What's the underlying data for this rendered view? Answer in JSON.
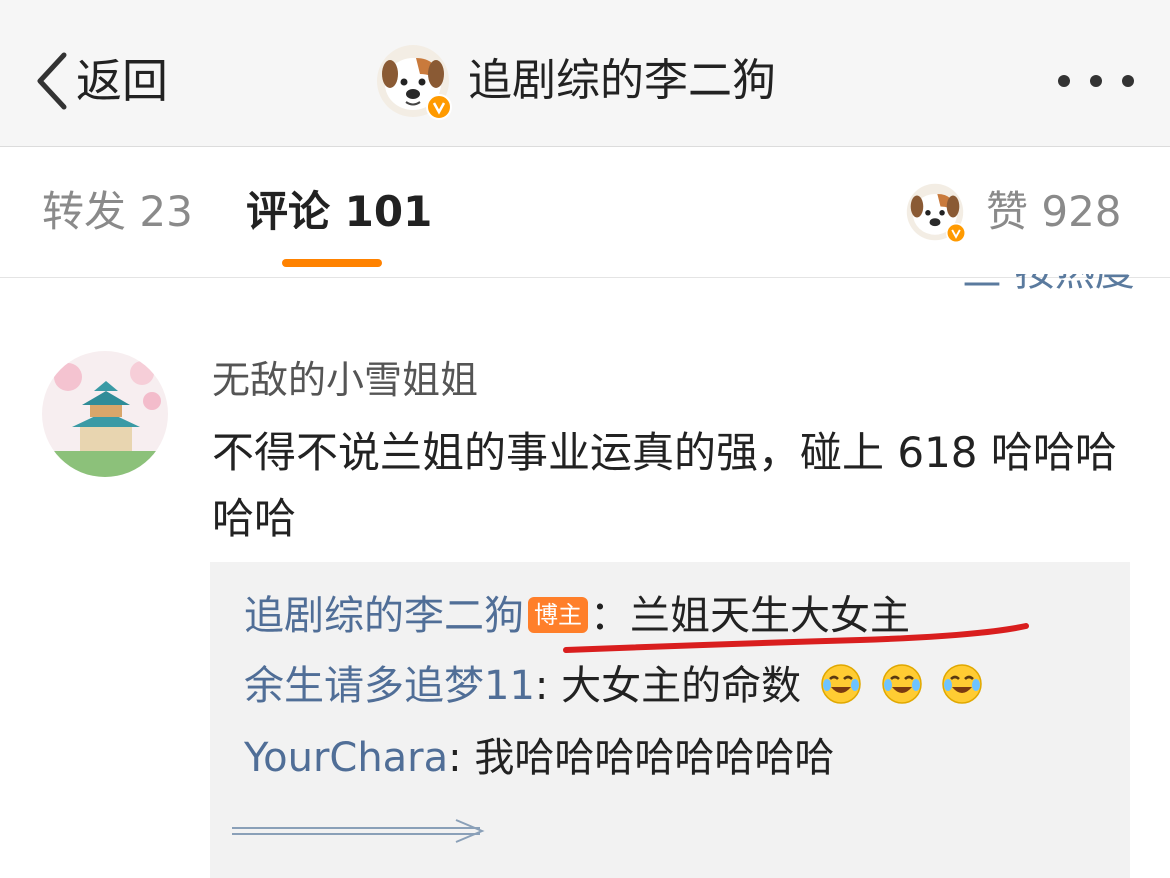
{
  "nav": {
    "back_label": "返回",
    "title": "追剧综的李二狗"
  },
  "tabs": {
    "repost": "转发 23",
    "comment": "评论 101",
    "like": "赞 928",
    "sort_peek": "三 按热度"
  },
  "comment": {
    "username": "无敌的小雪姐姐",
    "text": "不得不说兰姐的事业运真的强，碰上 618 哈哈哈哈哈",
    "replies": [
      {
        "name": "追剧综的李二狗",
        "badge": "博主",
        "sep": "：",
        "text": "兰姐天生大女主"
      },
      {
        "name": "余生请多追梦11",
        "sep": ": ",
        "text": "大女主的命数"
      },
      {
        "name": "YourChara",
        "sep": ": ",
        "text": "我哈哈哈哈哈哈哈哈"
      }
    ]
  },
  "colors": {
    "accent": "#ff8200",
    "link": "#506e97",
    "badge": "#ff7f2a",
    "annotation": "#d91e1e"
  },
  "icons": [
    "back-chevron-icon",
    "dog-avatar-icon",
    "verified-badge-icon",
    "more-dots-icon",
    "laughing-tears-emoji-icon",
    "expand-arrow-icon"
  ]
}
